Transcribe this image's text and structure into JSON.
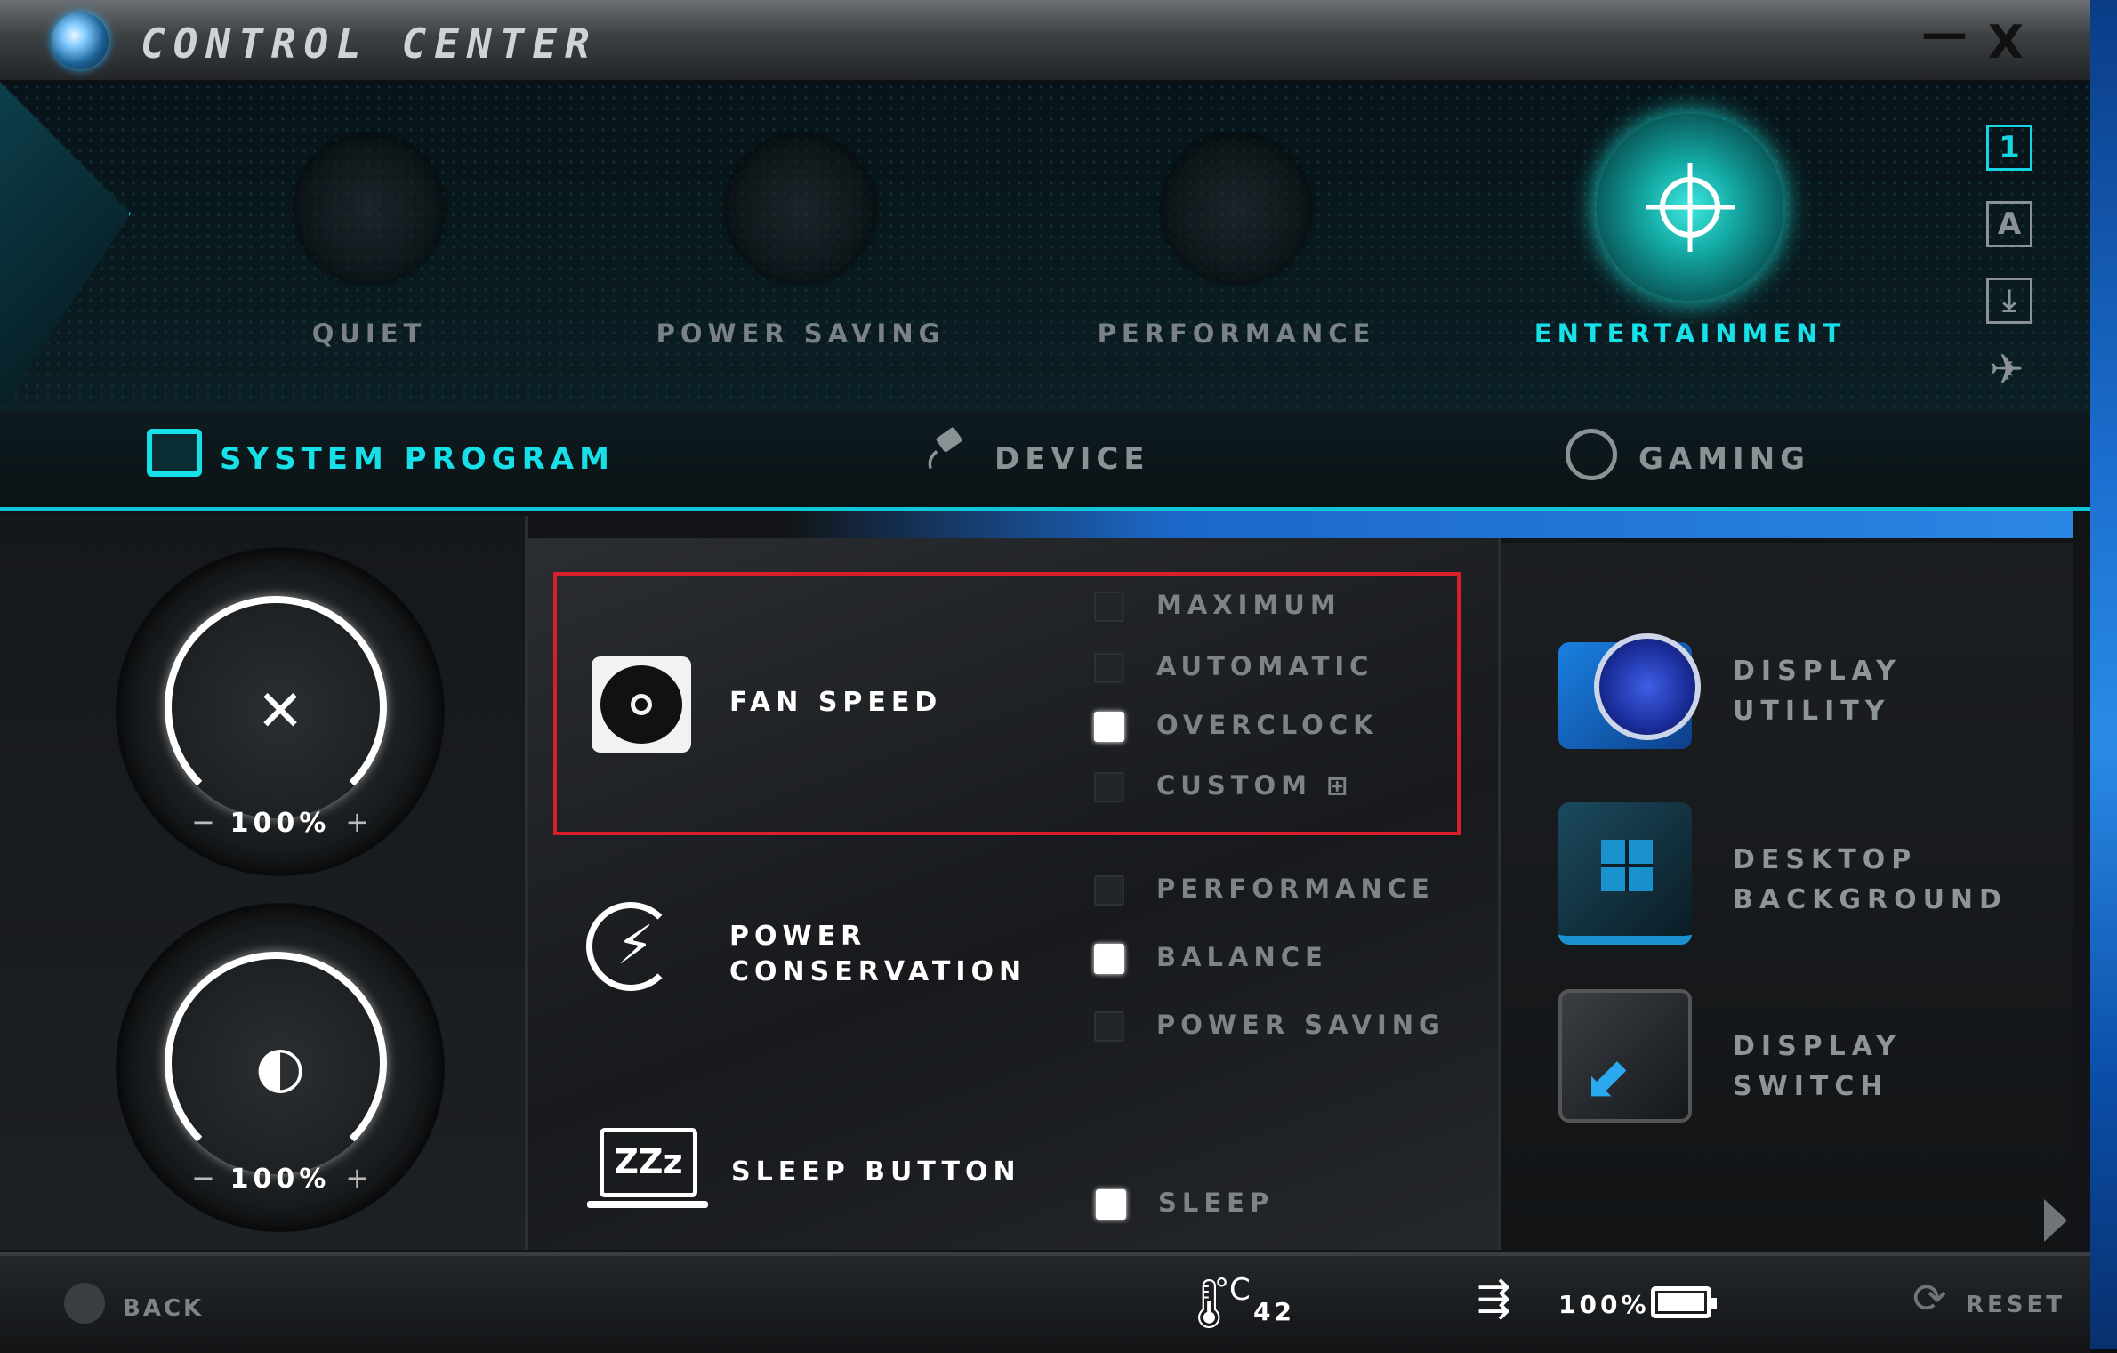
{
  "window": {
    "title": "Control Center",
    "minimize_glyph": "—",
    "close_glyph": "X"
  },
  "modes": {
    "active": "ENTERTAINMENT",
    "items": [
      {
        "label": "QUIET",
        "icon": "speaker-icon"
      },
      {
        "label": "POWER SAVING",
        "icon": "windmill-icon"
      },
      {
        "label": "PERFORMANCE",
        "icon": "speedometer-icon"
      },
      {
        "label": "ENTERTAINMENT",
        "icon": "radar-target-icon"
      }
    ]
  },
  "side_icons": {
    "profile_1": "1",
    "profile_a": "A",
    "download": "⤓",
    "airplane": "✈"
  },
  "tabs": {
    "active": "SYSTEM PROGRAM",
    "items": [
      {
        "label": "SYSTEM PROGRAM",
        "icon": "monitor-icon"
      },
      {
        "label": "DEVICE",
        "icon": "plug-icon"
      },
      {
        "label": "GAMING",
        "icon": "steering-wheel-icon"
      }
    ]
  },
  "dials": {
    "volume": {
      "value": "100%",
      "level": 1.0,
      "icon": "mute-icon",
      "center_glyph": "✕",
      "minus": "−",
      "plus": "+"
    },
    "brightness": {
      "value": "100%",
      "level": 1.0,
      "icon": "brightness-icon",
      "center_glyph": "◐",
      "minus": "−",
      "plus": "+"
    }
  },
  "fan_speed": {
    "label": "FAN SPEED",
    "options": [
      "MAXIMUM",
      "AUTOMATIC",
      "OVERCLOCK",
      "CUSTOM"
    ],
    "selected": "OVERCLOCK",
    "custom_add_glyph": "⊞"
  },
  "power_conservation": {
    "label_line1": "POWER",
    "label_line2": "CONSERVATION",
    "options": [
      "PERFORMANCE",
      "BALANCE",
      "POWER SAVING"
    ],
    "selected": "BALANCE",
    "bolt_glyph": "⚡"
  },
  "sleep_button": {
    "label": "SLEEP BUTTON",
    "icon_text": "ZZz",
    "options": [
      "SLEEP"
    ],
    "selected": "SLEEP"
  },
  "utilities": [
    {
      "line1": "DISPLAY",
      "line2": "UTILITY",
      "icon": "display-utility-icon"
    },
    {
      "line1": "DESKTOP",
      "line2": "BACKGROUND",
      "icon": "windows-logo-icon"
    },
    {
      "line1": "DISPLAY",
      "line2": "SWITCH",
      "icon": "display-switch-icon",
      "arrow_glyph": "⬋"
    }
  ],
  "footer": {
    "back_label": "BACK",
    "temperature_unit": "°C",
    "temperature_value": "42",
    "thermometer_glyph": "🌡",
    "battery_value": "100%",
    "battery_level": 1.0,
    "plug_glyph": "⇶",
    "reset_label": "RESET",
    "reset_glyph": "⟳"
  },
  "colors": {
    "accent_cyan": "#17e0e8",
    "highlight_red": "#d81f2b",
    "inactive_text": "#7d8488"
  }
}
